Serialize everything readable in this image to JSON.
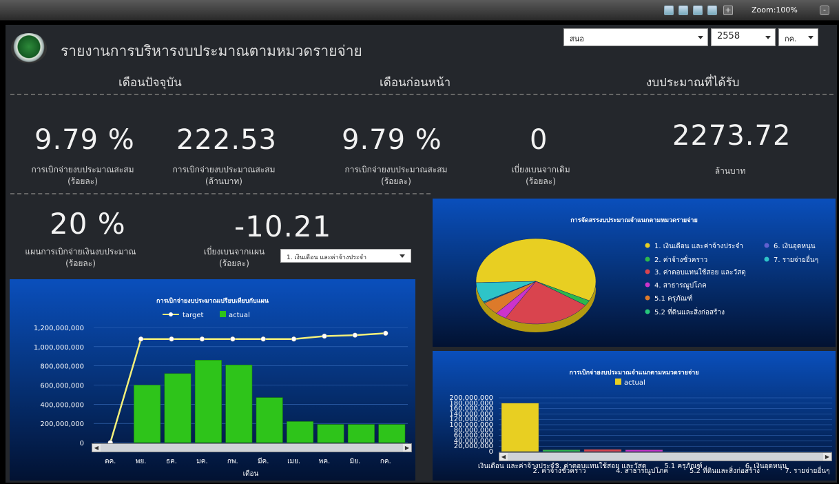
{
  "toolbar": {
    "zoom": "Zoom:100%",
    "icons": [
      "refresh-icon",
      "export-icon",
      "users-icon",
      "layout-icon",
      "add-icon"
    ]
  },
  "dashboard": {
    "title": "รายงานการบริหารงบประมาณตามหมวดรายจ่าย",
    "filters": {
      "unit": "สนอ",
      "year": "2558",
      "month": "กค."
    },
    "headers": {
      "current": "เดือนปัจจุบัน",
      "previous": "เดือนก่อนหน้า",
      "budget": "งบประมาณที่ได้รับ"
    },
    "kpis": [
      {
        "value": "9.79 %",
        "caption1": "การเบิกจ่ายงบประมาณสะสม",
        "caption2": "(ร้อยละ)"
      },
      {
        "value": "222.53",
        "caption1": "การเบิกจ่ายงบประมาณสะสม",
        "caption2": "(ล้านบาท)"
      },
      {
        "value": "9.79 %",
        "caption1": "การเบิกจ่ายงบประมาณสะสม",
        "caption2": "(ร้อยละ)"
      },
      {
        "value": "0",
        "caption1": "เบี่ยงเบนจากเดิม",
        "caption2": "(ร้อยละ)"
      },
      {
        "value": "2273.72",
        "caption1": "ล้านบาท",
        "caption2": ""
      }
    ],
    "plan": {
      "value": "20 %",
      "caption1": "แผนการเบิกจ่ายเงินงบประมาณ",
      "caption2": "(ร้อยละ)"
    },
    "deviation": {
      "value": "-10.21",
      "caption1": "เบี่ยงเบนจากแผน",
      "caption2": "(ร้อยละ)",
      "select": "1. เงินเดือน และค่าจ้างประจำ"
    }
  },
  "chart_data": [
    {
      "type": "bar",
      "title": "การเบิกจ่ายงบประมาณเปรียบเทียบกับแผน",
      "xlabel": "เดือน",
      "categories": [
        "ตค.",
        "พย.",
        "ธค.",
        "มค.",
        "กพ.",
        "มีค.",
        "เมย.",
        "พค.",
        "มิย.",
        "กค."
      ],
      "series": [
        {
          "name": "target",
          "kind": "line",
          "color": "#f4f07a",
          "values": [
            0,
            1080000000,
            1080000000,
            1080000000,
            1080000000,
            1080000000,
            1080000000,
            1110000000,
            1120000000,
            1140000000
          ]
        },
        {
          "name": "actual",
          "kind": "bar",
          "color": "#2ec41a",
          "values": [
            0,
            600000000,
            720000000,
            860000000,
            810000000,
            470000000,
            220000000,
            190000000,
            190000000,
            190000000
          ]
        }
      ],
      "yticks": [
        "1,200,000,000",
        "1,000,000,000",
        "800,000,000",
        "600,000,000",
        "400,000,000",
        "200,000,000",
        "0"
      ],
      "ylim": [
        0,
        1200000000
      ]
    },
    {
      "type": "pie",
      "title": "การจัดสรรงบประมาณจำแนกตามหมวดรายจ่าย",
      "slices": [
        {
          "label": "1. เงินเดือน และค่าจ้างประจำ",
          "value": 58,
          "color": "#e8cf22"
        },
        {
          "label": "2. ค่าจ้างชั่วคราว",
          "value": 2,
          "color": "#2db84c"
        },
        {
          "label": "3. ค่าตอบแทนใช้สอย และวัสดุ",
          "value": 24,
          "color": "#d9444e"
        },
        {
          "label": "4. สาธารณูปโภค",
          "value": 3,
          "color": "#cc33cc"
        },
        {
          "label": "5.1 ครุภัณฑ์",
          "value": 5,
          "color": "#dd7a2a"
        },
        {
          "label": "5.2 ที่ดินและสิ่งก่อสร้าง",
          "value": 0.3,
          "color": "#27c77a"
        },
        {
          "label": "6. เงินอุดหนุน",
          "value": 0.2,
          "color": "#6060d0"
        },
        {
          "label": "7. รายจ่ายอื่นๆ",
          "value": 7.5,
          "color": "#2ec4c8"
        }
      ]
    },
    {
      "type": "bar",
      "title": "การเบิกจ่ายงบประมาณจำแนกตามหมวดรายจ่าย",
      "series": [
        {
          "name": "actual",
          "values": [
            180000000,
            4000000,
            8000000,
            5000000,
            0,
            0,
            0,
            0
          ]
        }
      ],
      "categories": [
        "เงินเดือน และค่าจ้างประจำ",
        "2. ค่าจ้างชั่วคราว",
        "3. ค่าตอบแทนใช้สอย และวัสดุ",
        "4. สาธารณูปโภค",
        "5.1 ครุภัณฑ์",
        "5.2 ที่ดินและสิ่งก่อสร้าง",
        "6. เงินอุดหนุน",
        "7. รายจ่ายอื่นๆ"
      ],
      "colors": [
        "#e8cf22",
        "#2db84c",
        "#d9444e",
        "#cc33cc",
        "#dd7a2a",
        "#27c77a",
        "#6060d0",
        "#2ec4c8"
      ],
      "yticks": [
        "200,000,000",
        "180,000,000",
        "160,000,000",
        "140,000,000",
        "120,000,000",
        "100,000,000",
        "80,000,000",
        "60,000,000",
        "40,000,000",
        "20,000,000",
        "0"
      ],
      "ylim": [
        0,
        200000000
      ]
    }
  ]
}
